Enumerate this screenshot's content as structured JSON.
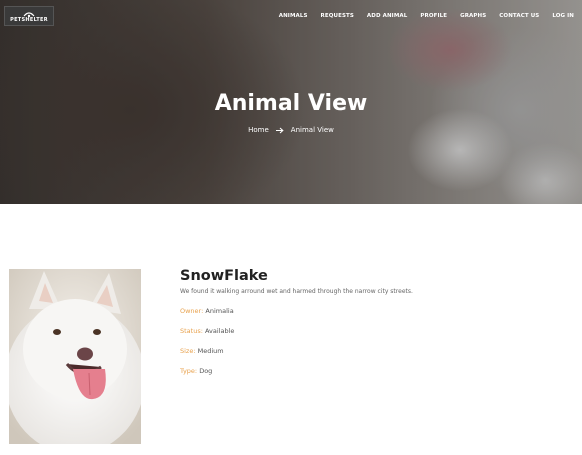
{
  "brand": {
    "logo_text": "PETSHELTER"
  },
  "nav": {
    "items": [
      {
        "label": "ANIMALS"
      },
      {
        "label": "REQUESTS"
      },
      {
        "label": "ADD ANIMAL"
      },
      {
        "label": "PROFILE"
      },
      {
        "label": "GRAPHS"
      },
      {
        "label": "CONTACT US"
      },
      {
        "label": "LOG IN"
      }
    ]
  },
  "hero": {
    "title": "Animal View",
    "breadcrumb": {
      "home": "Home",
      "current": "Animal View"
    }
  },
  "animal": {
    "name": "SnowFlake",
    "description": "We found it walking arround wet and harmed through the narrow city streets.",
    "fields": {
      "owner": {
        "label": "Owner:",
        "value": "Animalia"
      },
      "status": {
        "label": "Status:",
        "value": "Available"
      },
      "size": {
        "label": "Size:",
        "value": "Medium"
      },
      "type": {
        "label": "Type:",
        "value": "Dog"
      }
    }
  },
  "colors": {
    "accent": "#e8a24e",
    "text": "#222222",
    "muted": "#666666"
  }
}
